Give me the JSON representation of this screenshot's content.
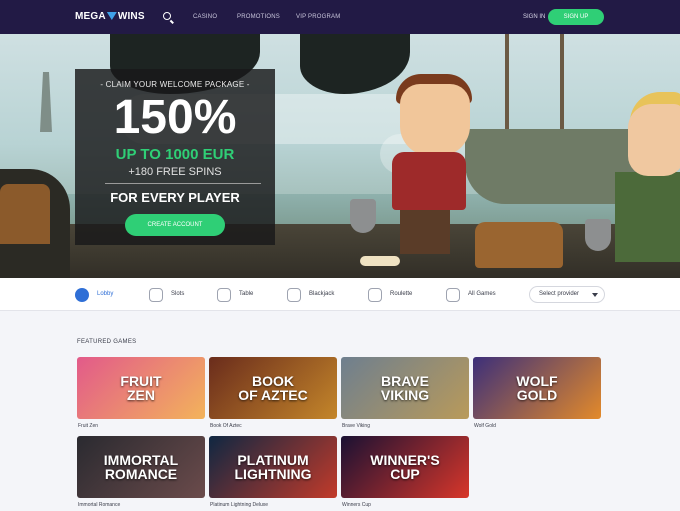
{
  "header": {
    "logo_text_1": "MEGA",
    "logo_text_2": "WINS",
    "nav": [
      "CASINO",
      "PROMOTIONS",
      "VIP PROGRAM"
    ],
    "sign_in": "SIGN IN",
    "sign_up": "SIGN UP"
  },
  "hero": {
    "pre_title": "- CLAIM YOUR WELCOME PACKAGE -",
    "percent": "150%",
    "up_to": "UP TO 1000 EUR",
    "spins": "+180 FREE SPINS",
    "every": "FOR EVERY PLAYER",
    "cta": "CREATE ACCOUNT",
    "slide_count": 3,
    "active_slide": 1
  },
  "categories": {
    "items": [
      {
        "label": "Lobby",
        "icon": "gamepad-icon",
        "active": true
      },
      {
        "label": "Slots",
        "icon": "slots-icon",
        "active": false
      },
      {
        "label": "Table",
        "icon": "chess-pawn-icon",
        "active": false
      },
      {
        "label": "Blackjack",
        "icon": "cards-icon",
        "active": false
      },
      {
        "label": "Roulette",
        "icon": "roulette-icon",
        "active": false
      },
      {
        "label": "All Games",
        "icon": "grid-icon",
        "active": false
      }
    ],
    "provider_select": "Select provider"
  },
  "featured": {
    "title": "FEATURED GAMES",
    "games": [
      {
        "name": "Fruit Zen",
        "thumb_title": "FRUIT\nZEN",
        "bg": "#e25a8a",
        "bg2": "#f3b35b"
      },
      {
        "name": "Book Of Aztec",
        "thumb_title": "BOOK\nOF AZTEC",
        "bg": "#6a2c1c",
        "bg2": "#c4862a"
      },
      {
        "name": "Brave Viking",
        "thumb_title": "BRAVE\nVIKING",
        "bg": "#6e7f8f",
        "bg2": "#b99a5a"
      },
      {
        "name": "Wolf Gold",
        "thumb_title": "WOLF\nGOLD",
        "bg": "#3c2f7a",
        "bg2": "#e38a2a"
      },
      {
        "name": "Immortal Romance",
        "thumb_title": "IMMORTAL\nROMANCE",
        "bg": "#2a2a30",
        "bg2": "#6b4b4b"
      },
      {
        "name": "Platinum Lightning Deluxe",
        "thumb_title": "PLATINUM\nLIGHTNING",
        "bg": "#0f2742",
        "bg2": "#c23a2a"
      },
      {
        "name": "Winners Cup",
        "thumb_title": "WINNER'S\nCUP",
        "bg": "#1a1133",
        "bg2": "#d8362a"
      }
    ]
  }
}
